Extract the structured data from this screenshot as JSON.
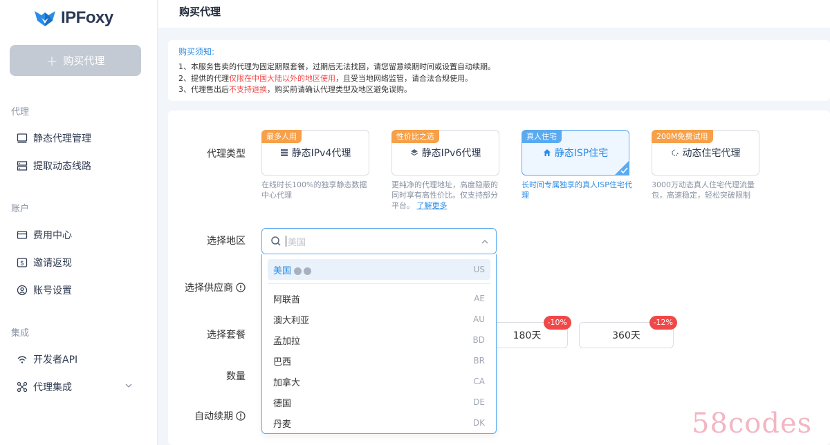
{
  "brand": {
    "name": "IPFoxy"
  },
  "sidebar": {
    "buy_button": "购买代理",
    "sections": {
      "proxy": "代理",
      "account": "账户",
      "integration": "集成"
    },
    "items": [
      {
        "label": "静态代理管理",
        "icon": "monitor-icon"
      },
      {
        "label": "提取动态线路",
        "icon": "server-icon"
      },
      {
        "label": "费用中心",
        "icon": "wallet-icon"
      },
      {
        "label": "邀请返现",
        "icon": "dollar-icon"
      },
      {
        "label": "账号设置",
        "icon": "user-icon"
      },
      {
        "label": "开发者API",
        "icon": "api-icon"
      },
      {
        "label": "代理集成",
        "icon": "integration-icon"
      }
    ]
  },
  "header": {
    "title": "购买代理"
  },
  "notice": {
    "title": "购买须知:",
    "line1": "1、本服务售卖的代理为固定期限套餐，过期后无法找回，请您留意续期时间或设置自动续期。",
    "line2_pre": "2、提供的代理",
    "line2_red": "仅限在中国大陆以外的地区使用",
    "line2_post": "，且受当地网络监管，请合法合规使用。",
    "line3_pre": "3、代理售出后",
    "line3_red": "不支持退换",
    "line3_post": "，购买前请确认代理类型及地区避免误购。"
  },
  "form": {
    "labels": {
      "proxy_type": "代理类型",
      "region": "选择地区",
      "provider": "选择供应商",
      "plan": "选择套餐",
      "quantity": "数量",
      "auto_renew": "自动续期"
    },
    "proxy_types": [
      {
        "tag": "最多人用",
        "name": "静态IPv4代理",
        "desc": "在线时长100%的独享静态数据中心代理"
      },
      {
        "tag": "性价比之选",
        "name": "静态IPv6代理",
        "desc": "更纯净的代理地址，高度隐蔽的同时享有高性价比。仅支持部分平台。",
        "more": "了解更多"
      },
      {
        "tag": "真人住宅",
        "name": "静态ISP住宅",
        "desc": "长时间专属独享的真人ISP住宅代理"
      },
      {
        "tag": "200M免费试用",
        "name": "动态住宅代理",
        "desc": "3000万动态真人住宅代理流量包，高速稳定，轻松突破限制"
      }
    ],
    "region_placeholder": "美国",
    "region_options": [
      {
        "name": "美国",
        "code": "US"
      },
      {
        "name": "阿联酋",
        "code": "AE"
      },
      {
        "name": "澳大利亚",
        "code": "AU"
      },
      {
        "name": "孟加拉",
        "code": "BD"
      },
      {
        "name": "巴西",
        "code": "BR"
      },
      {
        "name": "加拿大",
        "code": "CA"
      },
      {
        "name": "德国",
        "code": "DE"
      },
      {
        "name": "丹麦",
        "code": "DK"
      }
    ],
    "plans": [
      {
        "label": "180天",
        "discount": "-10%"
      },
      {
        "label": "360天",
        "discount": "-12%"
      }
    ]
  },
  "watermark": "58codes",
  "colors": {
    "accent": "#2b8ce6",
    "tag_orange": "#f7a04a",
    "discount_red": "#f04848"
  }
}
